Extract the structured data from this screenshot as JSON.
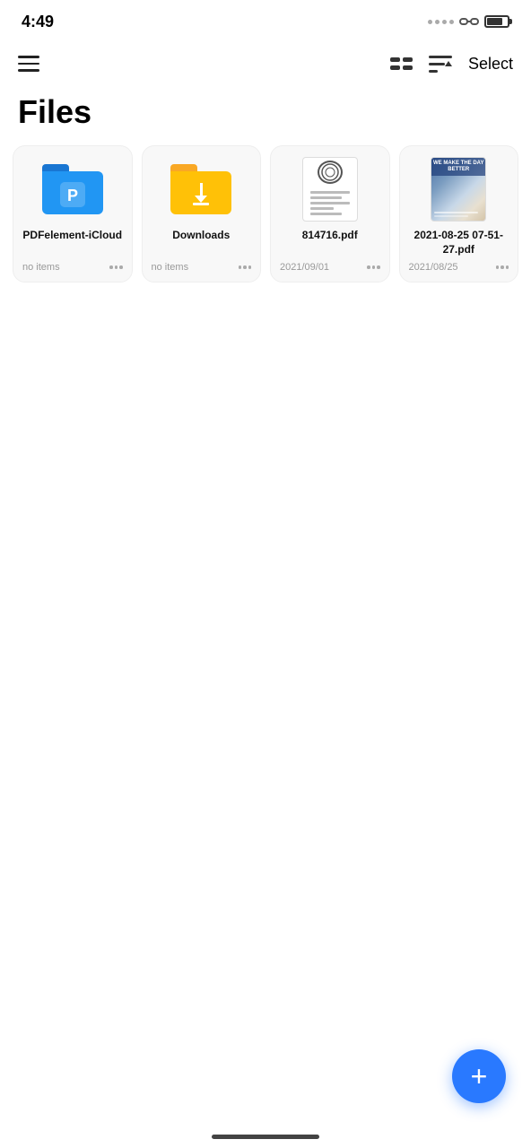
{
  "statusBar": {
    "time": "4:49"
  },
  "header": {
    "selectLabel": "Select",
    "pageTitle": "Files"
  },
  "files": [
    {
      "id": "pdelement-icloud",
      "type": "folder-blue",
      "name": "PDFelement-iCloud",
      "meta": "no items",
      "hasMoreBtn": true
    },
    {
      "id": "downloads",
      "type": "folder-yellow",
      "name": "Downloads",
      "meta": "no items",
      "hasMoreBtn": true
    },
    {
      "id": "814716-pdf",
      "type": "pdf-doc",
      "name": "814716.pdf",
      "meta": "2021/09/01",
      "hasMoreBtn": true
    },
    {
      "id": "2021-08-25-pdf",
      "type": "pdf-photo",
      "name": "2021-08-25 07-51-27.pdf",
      "meta": "2021/08/25",
      "hasMoreBtn": true
    }
  ],
  "fab": {
    "label": "+"
  }
}
